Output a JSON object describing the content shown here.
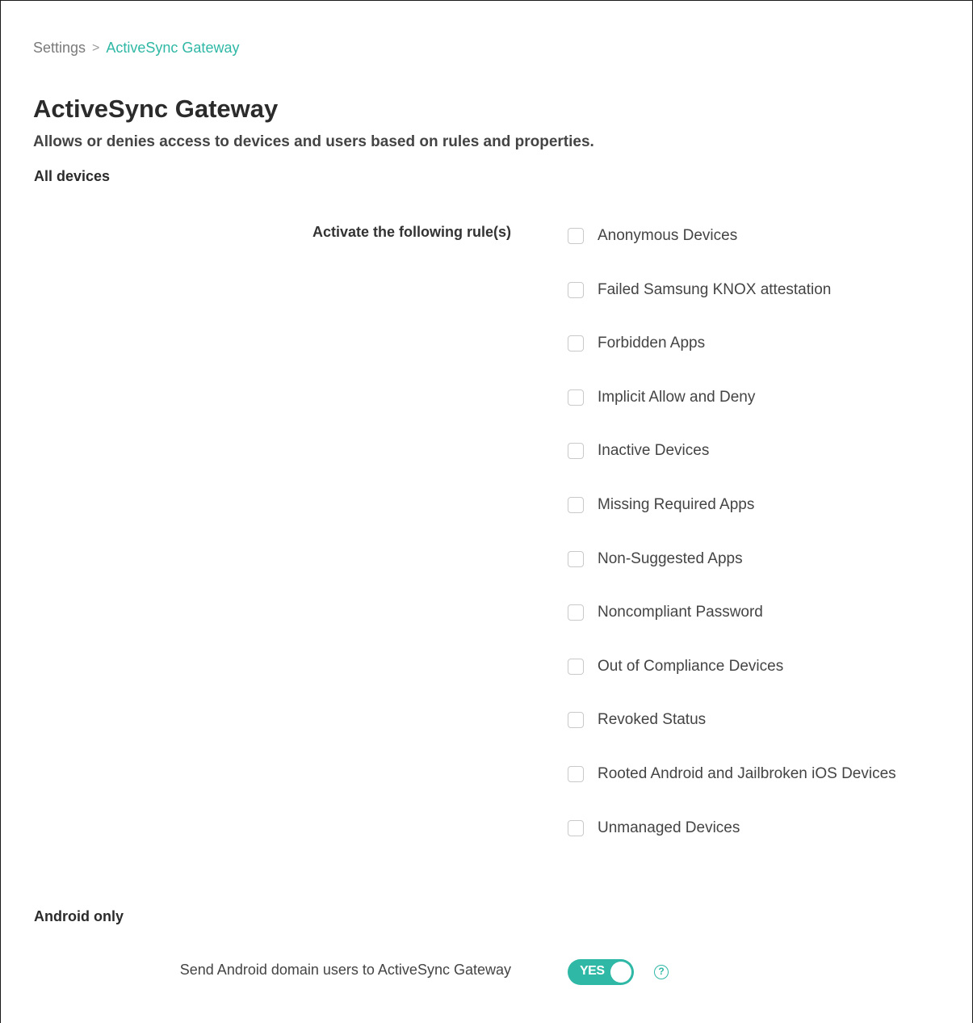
{
  "breadcrumb": {
    "root": "Settings",
    "separator": ">",
    "current": "ActiveSync Gateway"
  },
  "page": {
    "title": "ActiveSync Gateway",
    "subtitle": "Allows or denies access to devices and users based on rules and properties."
  },
  "all_devices": {
    "heading": "All devices",
    "rules_label": "Activate the following rule(s)",
    "rules": [
      {
        "label": "Anonymous Devices",
        "checked": false
      },
      {
        "label": "Failed Samsung KNOX attestation",
        "checked": false
      },
      {
        "label": "Forbidden Apps",
        "checked": false
      },
      {
        "label": "Implicit Allow and Deny",
        "checked": false
      },
      {
        "label": "Inactive Devices",
        "checked": false
      },
      {
        "label": "Missing Required Apps",
        "checked": false
      },
      {
        "label": "Non-Suggested Apps",
        "checked": false
      },
      {
        "label": "Noncompliant Password",
        "checked": false
      },
      {
        "label": "Out of Compliance Devices",
        "checked": false
      },
      {
        "label": "Revoked Status",
        "checked": false
      },
      {
        "label": "Rooted Android and Jailbroken iOS Devices",
        "checked": false
      },
      {
        "label": "Unmanaged Devices",
        "checked": false
      }
    ]
  },
  "android_only": {
    "heading": "Android only",
    "setting_label": "Send Android domain users to ActiveSync Gateway",
    "toggle_value": "YES",
    "toggle_on": true,
    "help_icon": "question-circle-icon",
    "help_glyph": "?"
  },
  "colors": {
    "accent": "#2fb8a5",
    "text": "#333333",
    "muted": "#7a7a7a",
    "checkbox_border": "#c9c9c9"
  }
}
